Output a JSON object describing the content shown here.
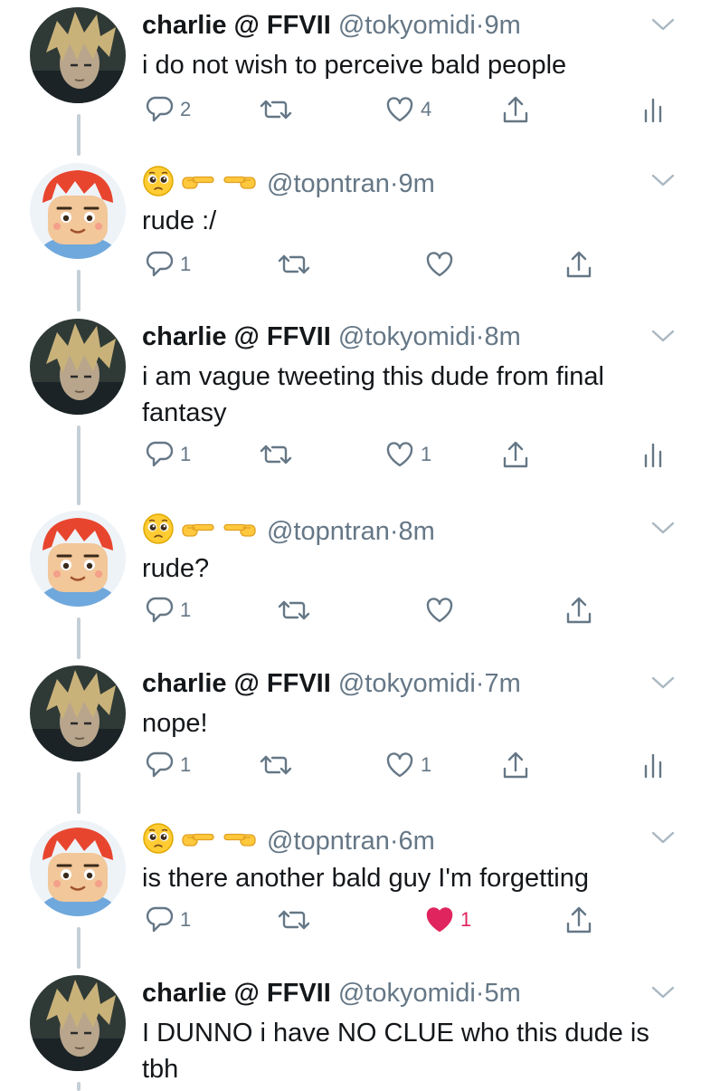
{
  "tweets": [
    {
      "author": "charlie",
      "name": "charlie @ FFVII",
      "handle": "@tokyomidi",
      "sep": "·",
      "time": "9m",
      "text": "i do not wish to perceive bald people",
      "replies": "2",
      "retweets": "",
      "likes": "4",
      "liked": false,
      "analytics": true
    },
    {
      "author": "topntran",
      "name": "",
      "handle": "@topntran",
      "sep": "·",
      "time": "9m",
      "text": "rude :/",
      "replies": "1",
      "retweets": "",
      "likes": "",
      "liked": false,
      "analytics": false
    },
    {
      "author": "charlie",
      "name": "charlie @ FFVII",
      "handle": "@tokyomidi",
      "sep": "·",
      "time": "8m",
      "text": "i am vague tweeting this dude from final fantasy",
      "replies": "1",
      "retweets": "",
      "likes": "1",
      "liked": false,
      "analytics": true
    },
    {
      "author": "topntran",
      "name": "",
      "handle": "@topntran",
      "sep": "·",
      "time": "8m",
      "text": "rude?",
      "replies": "1",
      "retweets": "",
      "likes": "",
      "liked": false,
      "analytics": false
    },
    {
      "author": "charlie",
      "name": "charlie @ FFVII",
      "handle": "@tokyomidi",
      "sep": "·",
      "time": "7m",
      "text": "nope!",
      "replies": "1",
      "retweets": "",
      "likes": "1",
      "liked": false,
      "analytics": true
    },
    {
      "author": "topntran",
      "name": "",
      "handle": "@topntran",
      "sep": "·",
      "time": "6m",
      "text": "is there another bald guy I'm forgetting",
      "replies": "1",
      "retweets": "",
      "likes": "1",
      "liked": true,
      "analytics": false
    },
    {
      "author": "charlie",
      "name": "charlie @ FFVII",
      "handle": "@tokyomidi",
      "sep": "·",
      "time": "5m",
      "text": "I DUNNO i have NO CLUE who this dude is tbh",
      "replies": "",
      "retweets": "",
      "likes": "",
      "liked": false,
      "analytics": false
    }
  ],
  "icons": {
    "reply": "reply-icon",
    "retweet": "retweet-icon",
    "like": "heart-icon",
    "like_filled": "heart-filled-icon",
    "share": "share-icon",
    "analytics": "analytics-icon",
    "caret": "chevron-down-icon",
    "emoji": [
      "pleading-face-emoji",
      "pointing-right-emoji",
      "pointing-left-emoji"
    ]
  },
  "colors": {
    "text": "#14171a",
    "secondary": "#657786",
    "icon": "#657786",
    "liked": "#e0245e",
    "thread_line": "#c4cfd6",
    "background": "#ffffff"
  }
}
